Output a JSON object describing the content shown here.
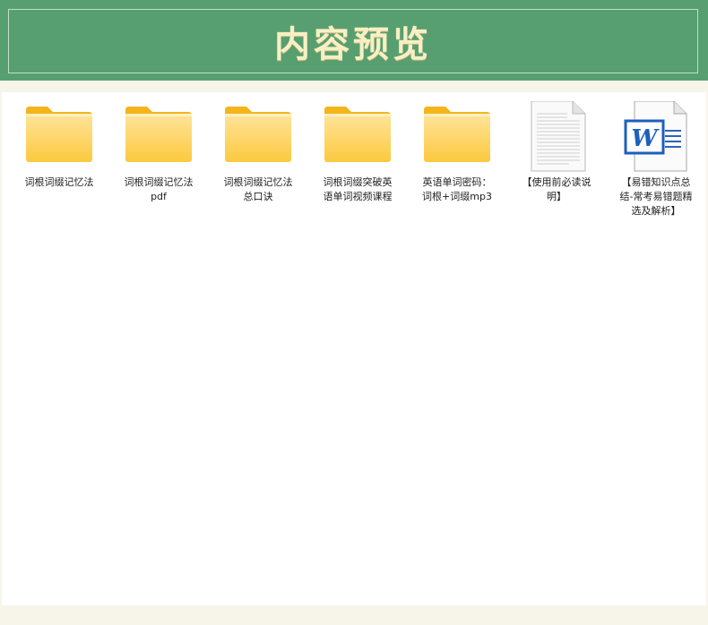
{
  "banner": {
    "title": "内容预览"
  },
  "files": [
    {
      "type": "folder",
      "icon": "folder-icon",
      "name": "词根词缀记忆法"
    },
    {
      "type": "folder",
      "icon": "folder-icon",
      "name": "词根词缀记忆法\npdf"
    },
    {
      "type": "folder",
      "icon": "folder-icon",
      "name": "词根词缀记忆法\n总口诀"
    },
    {
      "type": "folder",
      "icon": "folder-icon",
      "name": "词根词缀突破英\n语单词视频课程"
    },
    {
      "type": "folder",
      "icon": "folder-icon",
      "name": "英语单词密码：\n词根+词缀mp3"
    },
    {
      "type": "text-document",
      "icon": "text-document-icon",
      "name": "【使用前必读说\n明】"
    },
    {
      "type": "word-document",
      "icon": "word-document-icon",
      "name": "【易错知识点总\n结-常考易错题精\n选及解析】"
    }
  ]
}
